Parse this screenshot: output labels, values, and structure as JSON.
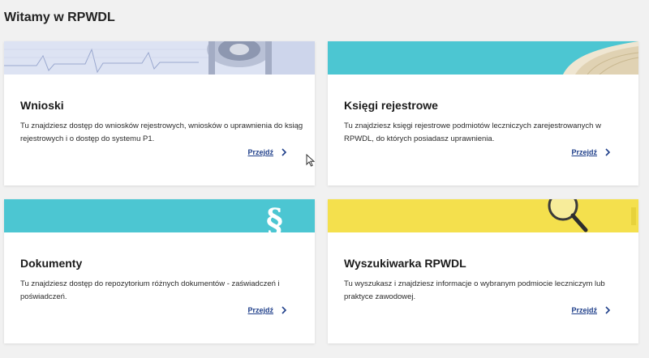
{
  "header": {
    "title": "Witamy w RPWDL"
  },
  "cards": [
    {
      "title": "Wnioski",
      "description": "Tu znajdziesz dostęp do wniosków rejestrowych, wniosków o uprawnienia do ksiąg rejestrowych i o dostęp do systemu P1.",
      "link_label": "Przejdź",
      "banner_color": "#dfe5f4"
    },
    {
      "title": "Księgi rejestrowe",
      "description": "Tu znajdziesz księgi rejestrowe podmiotów leczniczych zarejestrowanych w RPWDL, do których posiadasz uprawnienia.",
      "link_label": "Przejdź",
      "banner_color": "#4cc6d2"
    },
    {
      "title": "Dokumenty",
      "description": "Tu znajdziesz dostęp do repozytorium różnych dokumentów - zaświadczeń i poświadczeń.",
      "link_label": "Przejdź",
      "banner_color": "#4cc6d2"
    },
    {
      "title": "Wyszukiwarka RPWDL",
      "description": "Tu wyszukasz i znajdziesz informacje o wybranym podmiocie leczniczym lub praktyce zawodowej.",
      "link_label": "Przejdź",
      "banner_color": "#f4e04d"
    }
  ],
  "icons": {
    "link": "chevron-right-icon",
    "banner_1": "stethoscope-ecg-image",
    "banner_2": "open-book-image",
    "banner_3": "paragraph-sign-image",
    "banner_4": "magnifier-image"
  },
  "colors": {
    "background": "#f1f1f1",
    "card": "#ffffff",
    "link": "#1f3f8a"
  }
}
